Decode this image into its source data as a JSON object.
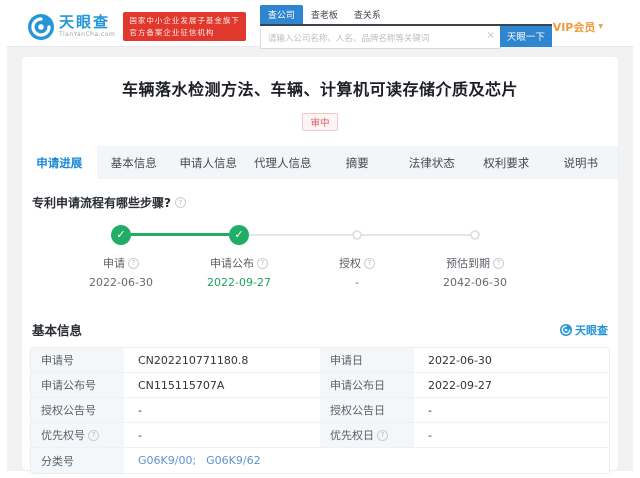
{
  "icons": {
    "help": "?",
    "check": "✓",
    "clear": "×",
    "caret": "▼"
  },
  "header": {
    "brand": "天眼查",
    "brand_domain": "TianYanCha.com",
    "gov_badge_line1": "国家中小企业发展子基金旗下",
    "gov_badge_line2": "官方备案企业征信机构",
    "search_tabs": [
      "查公司",
      "查老板",
      "查关系"
    ],
    "search_placeholder": "请输入公司名称、人名、品牌名称等关键词",
    "search_button": "天眼一下",
    "vip_label": "VIP会员"
  },
  "patent": {
    "title": "车辆落水检测方法、车辆、计算机可读存储介质及芯片",
    "status": "审中"
  },
  "tabs": [
    "申请进展",
    "基本信息",
    "申请人信息",
    "代理人信息",
    "摘要",
    "法律状态",
    "权利要求",
    "说明书"
  ],
  "progress": {
    "question": "专利申请流程有哪些步骤?",
    "steps": [
      {
        "label": "申请",
        "date": "2022-06-30"
      },
      {
        "label": "申请公布",
        "date": "2022-09-27"
      },
      {
        "label": "授权",
        "date": "-"
      },
      {
        "label": "预估到期",
        "date": "2042-06-30"
      }
    ]
  },
  "basic_info": {
    "section_title": "基本信息",
    "watermark": "天眼查",
    "rows": [
      {
        "label1": "申请号",
        "value1": "CN202210771180.8",
        "label2": "申请日",
        "value2": "2022-06-30"
      },
      {
        "label1": "申请公布号",
        "value1": "CN115115707A",
        "label2": "申请公布日",
        "value2": "2022-09-27"
      },
      {
        "label1": "授权公告号",
        "value1": "-",
        "label2": "授权公告日",
        "value2": "-"
      },
      {
        "label1": "优先权号",
        "value1": "-",
        "label2": "优先权日",
        "value2": "-"
      },
      {
        "label1": "分类号"
      }
    ],
    "class_links": [
      "G06K9/00;",
      "G06K9/62"
    ]
  }
}
